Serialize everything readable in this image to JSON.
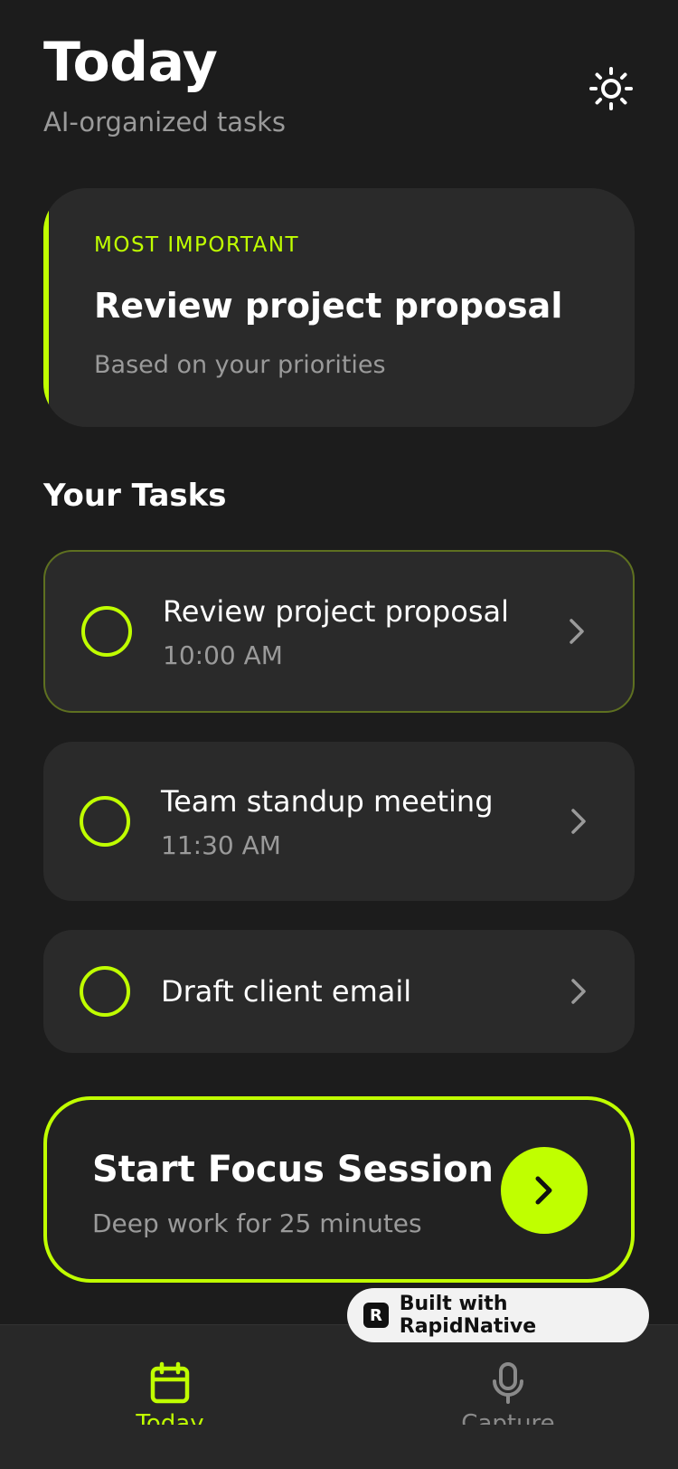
{
  "header": {
    "title": "Today",
    "subtitle": "AI-organized tasks",
    "theme_icon": "sun-icon"
  },
  "highlight": {
    "tag": "MOST IMPORTANT",
    "title": "Review project proposal",
    "subtitle": "Based on your priorities"
  },
  "tasks_section": {
    "title": "Your Tasks",
    "items": [
      {
        "name": "Review project proposal",
        "time": "10:00 AM"
      },
      {
        "name": "Team standup meeting",
        "time": "11:30 AM"
      },
      {
        "name": "Draft client email"
      }
    ]
  },
  "focus": {
    "title": "Start Focus Session",
    "subtitle": "Deep work for 25 minutes"
  },
  "badge": {
    "text": "Built with RapidNative",
    "logo": "R"
  },
  "tabbar": {
    "tabs": [
      {
        "label": "Today",
        "icon": "calendar-icon",
        "active": true
      },
      {
        "label": "Capture",
        "icon": "microphone-icon",
        "active": false
      }
    ]
  },
  "colors": {
    "accent": "#c0ff00",
    "background": "#1c1c1c",
    "card": "#2a2a2a",
    "muted": "#9a9a9a"
  }
}
